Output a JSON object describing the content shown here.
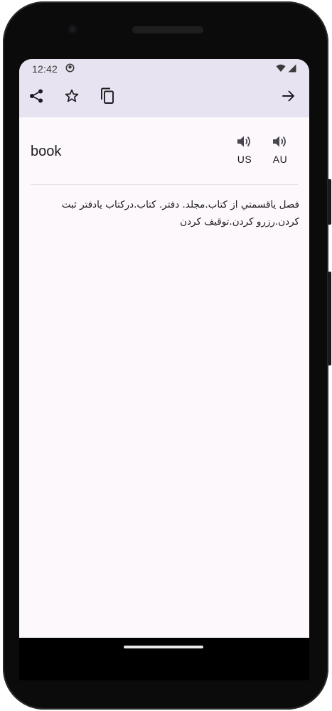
{
  "status": {
    "time": "12:42",
    "app_icon": "app-notification-icon",
    "wifi_icon": "wifi-icon",
    "signal_icon": "cellular-signal-icon"
  },
  "toolbar": {
    "share_icon": "share-icon",
    "favorite_icon": "star-outline-icon",
    "copy_icon": "copy-icon",
    "next_icon": "arrow-forward-icon"
  },
  "entry": {
    "word": "book",
    "pronunciations": [
      {
        "label": "US",
        "icon": "speaker-icon"
      },
      {
        "label": "AU",
        "icon": "speaker-icon"
      }
    ],
    "meaning": "فصل یاقسمتي از کتاب.مجلد. دفتر. کتاب.درکتاب یادفتر ثبت کردن.رزرو کردن.توقیف کردن"
  },
  "colors": {
    "toolbar_bg": "#e8e3f0",
    "screen_bg": "#fdf8fc",
    "text": "#1c1b1f"
  }
}
